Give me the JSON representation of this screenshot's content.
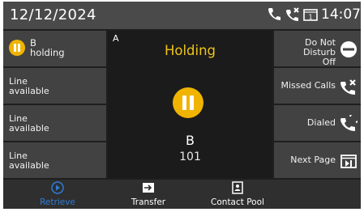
{
  "status": {
    "date": "12/12/2024",
    "time": "14:07",
    "icons": [
      "phone-icon",
      "missed-call-icon",
      "voicemail-icon"
    ]
  },
  "lines": [
    {
      "line1": "B",
      "line2": "holding",
      "state": "holding"
    },
    {
      "line1": "Line",
      "line2": "available"
    },
    {
      "line1": "Line",
      "line2": "available"
    },
    {
      "line1": "Line",
      "line2": "available"
    }
  ],
  "call": {
    "tag": "A",
    "state": "Holding",
    "name": "B",
    "number": "101"
  },
  "right_buttons": [
    {
      "line1": "Do Not Disturb",
      "line2": "Off",
      "icon": "dnd-icon"
    },
    {
      "line1": "Missed Calls",
      "icon": "missed-call-icon"
    },
    {
      "line1": "Dialed",
      "icon": "dialed-icon"
    },
    {
      "line1": "Next Page",
      "icon": "next-page-icon"
    }
  ],
  "softkeys": [
    {
      "label": "Retrieve",
      "icon": "play-icon"
    },
    {
      "label": "Transfer",
      "icon": "transfer-icon"
    },
    {
      "label": "Contact Pool",
      "icon": "contacts-icon"
    }
  ],
  "colors": {
    "hold": "#f0b400",
    "holding_text": "#f0c419",
    "accent": "#2e7bd6"
  }
}
